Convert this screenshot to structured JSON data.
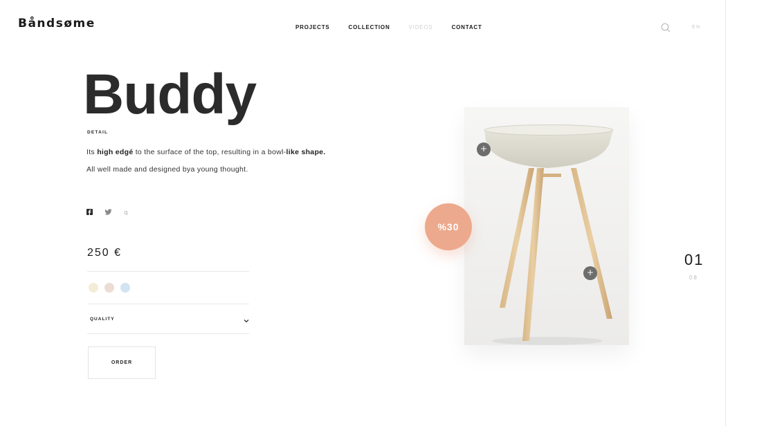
{
  "brand": {
    "logo": "Båndsøme"
  },
  "nav": [
    {
      "label": "PROJECTS",
      "active": true
    },
    {
      "label": "COLLECTION",
      "active": true
    },
    {
      "label": "VIDEOS",
      "active": false
    },
    {
      "label": "CONTACT",
      "active": true
    }
  ],
  "header": {
    "search_icon": "search-icon",
    "lang": "EN"
  },
  "product": {
    "title": "Buddy",
    "section_label": "DETAIL",
    "desc1": {
      "a": "Its ",
      "b": "high edgé",
      "c": " to the surface of the top, resulting in a bowl-",
      "d": "like shape."
    },
    "desc2": "All well made and designed  bya young thought.",
    "price": "250 €",
    "colors": [
      "#f3ecd7",
      "#ecdcd4",
      "#d2e3f2"
    ],
    "quality_label": "QUALITY",
    "order_label": "ORDER",
    "discount": "%30",
    "hotspot_label": "+"
  },
  "social": [
    "facebook-icon",
    "twitter-icon",
    "google-plus-icon"
  ],
  "pager": {
    "current": "01",
    "total": "08"
  }
}
